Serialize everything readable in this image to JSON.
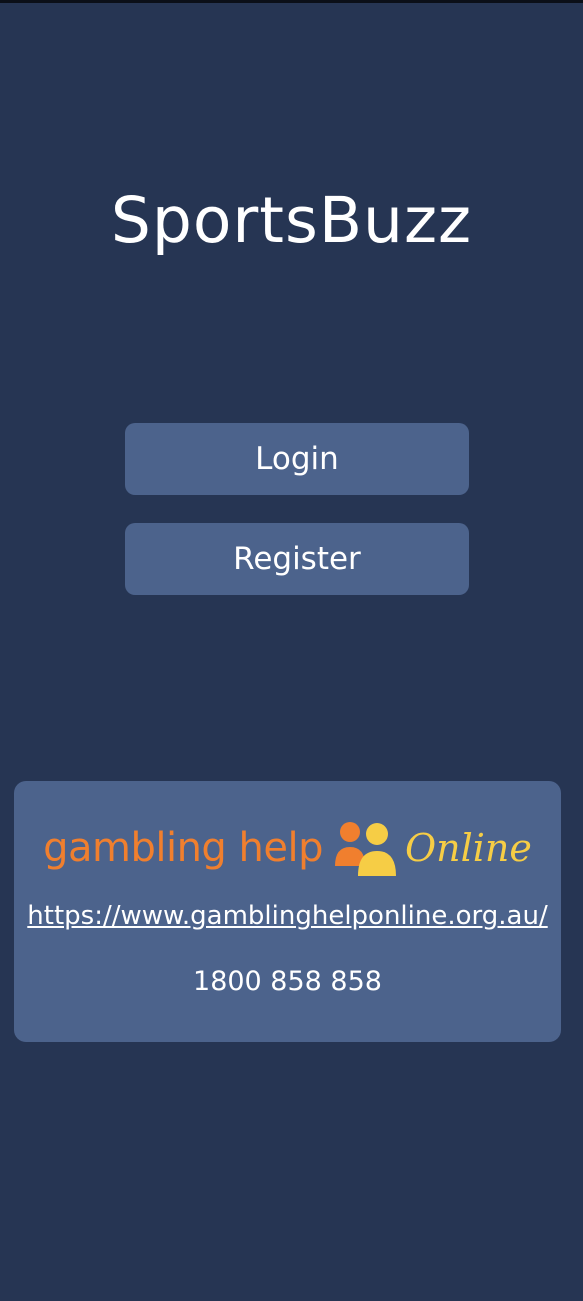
{
  "app": {
    "title": "SportsBuzz"
  },
  "auth": {
    "login_label": "Login",
    "register_label": "Register"
  },
  "help": {
    "logo_text_left": "gambling help",
    "logo_text_right": "Online",
    "logo_icon": "people-icon",
    "url": "https://www.gamblinghelponline.org.au/",
    "phone": "1800 858 858"
  },
  "colors": {
    "background": "#263553",
    "button": "#4c638c",
    "logo_orange": "#f07f2e",
    "logo_yellow": "#f6cd45"
  }
}
